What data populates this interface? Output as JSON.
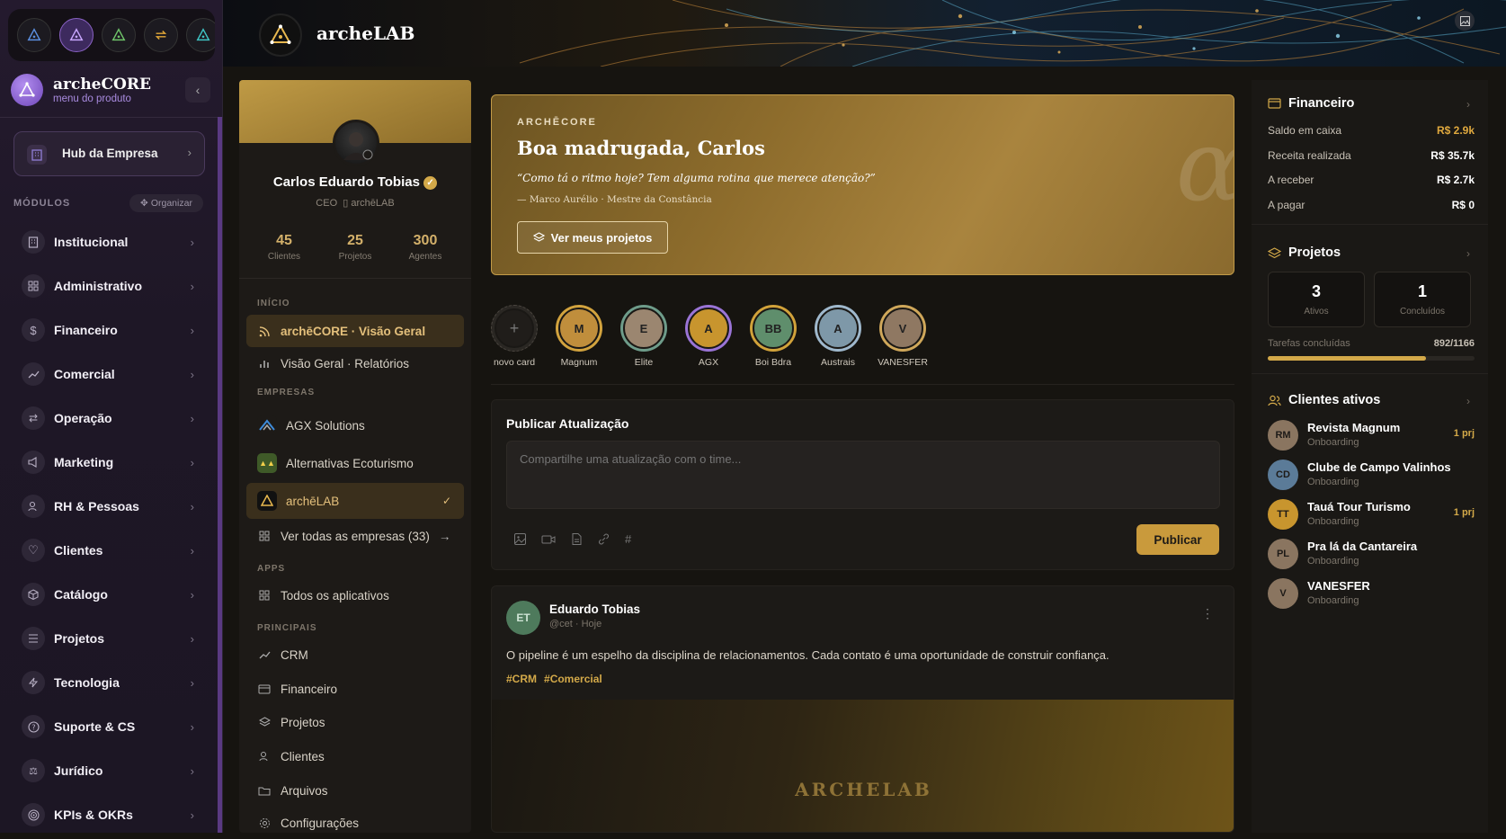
{
  "sidebar": {
    "brand_name": "archeCORE",
    "brand_sub": "menu do produto",
    "hub_label": "Hub da Empresa",
    "modules_heading": "MÓDULOS",
    "organize_label": "Organizar",
    "modules": [
      {
        "label": "Institucional",
        "icon": "building-icon"
      },
      {
        "label": "Administrativo",
        "icon": "grid-icon"
      },
      {
        "label": "Financeiro",
        "icon": "dollar-icon"
      },
      {
        "label": "Comercial",
        "icon": "trend-icon"
      },
      {
        "label": "Operação",
        "icon": "cycle-icon"
      },
      {
        "label": "Marketing",
        "icon": "megaphone-icon"
      },
      {
        "label": "RH & Pessoas",
        "icon": "people-icon"
      },
      {
        "label": "Clientes",
        "icon": "heart-icon"
      },
      {
        "label": "Catálogo",
        "icon": "box-icon"
      },
      {
        "label": "Projetos",
        "icon": "list-icon"
      },
      {
        "label": "Tecnologia",
        "icon": "bolt-icon"
      },
      {
        "label": "Suporte & CS",
        "icon": "help-icon"
      },
      {
        "label": "Jurídico",
        "icon": "scale-icon"
      },
      {
        "label": "KPIs & OKRs",
        "icon": "target-icon"
      }
    ]
  },
  "banner": {
    "title": "archeLAB"
  },
  "profile": {
    "name": "Carlos Eduardo Tobias",
    "role": "CEO",
    "company": "archēLAB",
    "stats": [
      {
        "value": "45",
        "label": "Clientes"
      },
      {
        "value": "25",
        "label": "Projetos"
      },
      {
        "value": "300",
        "label": "Agentes"
      }
    ],
    "sec_inicio": "INÍCIO",
    "nav_overview": "archēCORE · Visão Geral",
    "nav_reports": "Visão Geral · Relatórios",
    "sec_empresas": "EMPRESAS",
    "companies": [
      "AGX Solutions",
      "Alternativas Ecoturismo",
      "archēLAB"
    ],
    "see_all": "Ver todas as empresas (33)",
    "sec_apps": "APPS",
    "all_apps": "Todos os aplicativos",
    "sec_principais": "PRINCIPAIS",
    "principais": [
      "CRM",
      "Financeiro",
      "Projetos",
      "Clientes",
      "Arquivos",
      "Configurações"
    ]
  },
  "hero": {
    "eyebrow": "ARCHĒCORE",
    "title": "Boa madrugada, Carlos",
    "quote": "“Como tá o ritmo hoje? Tem alguma rotina que merece atenção?”",
    "author": "— Marco Aurélio · Mestre da Constância",
    "button": "Ver meus projetos",
    "glyph": "α"
  },
  "stories": [
    {
      "label": "novo card",
      "initials": "+",
      "ring": "#2a2723",
      "fill": "#201d1a"
    },
    {
      "label": "Magnum",
      "initials": "M",
      "ring": "#d2a33e",
      "fill": "#c08e3c"
    },
    {
      "label": "Elite",
      "initials": "E",
      "ring": "#6e9c8a",
      "fill": "#9b8670"
    },
    {
      "label": "AGX",
      "initials": "A",
      "ring": "#9a74d6",
      "fill": "#c8952e"
    },
    {
      "label": "Boi Bdra",
      "initials": "BB",
      "ring": "#d1a23a",
      "fill": "#5f8e6c"
    },
    {
      "label": "Austrais",
      "initials": "A",
      "ring": "#9fb8cc",
      "fill": "#7e98a8"
    },
    {
      "label": "VANESFER",
      "initials": "V",
      "ring": "#cfa75a",
      "fill": "#8f7862"
    }
  ],
  "composer": {
    "title": "Publicar Atualização",
    "placeholder": "Compartilhe uma atualização com o time...",
    "publish": "Publicar"
  },
  "post": {
    "initials": "ET",
    "author": "Eduardo Tobias",
    "meta": "@cet · Hoje",
    "text": "O pipeline é um espelho da disciplina de relacionamentos. Cada contato é uma oportunidade de construir confiança.",
    "tags": [
      "#CRM",
      "#Comercial"
    ],
    "image_text": "ARCHELAB"
  },
  "finance": {
    "title": "Financeiro",
    "rows": [
      {
        "label": "Saldo em caixa",
        "value": "R$ 2.9k",
        "color": "#e0a93e"
      },
      {
        "label": "Receita realizada",
        "value": "R$ 35.7k",
        "color": "#ffffff"
      },
      {
        "label": "A receber",
        "value": "R$ 2.7k",
        "color": "#ffffff"
      },
      {
        "label": "A pagar",
        "value": "R$ 0",
        "color": "#ffffff"
      }
    ]
  },
  "projects": {
    "title": "Projetos",
    "active": "3",
    "active_label": "Ativos",
    "done": "1",
    "done_label": "Concluídos",
    "tasks_label": "Tarefas concluídas",
    "tasks_value": "892/1166",
    "tasks_fraction": 0.765
  },
  "clients": {
    "title": "Clientes ativos",
    "items": [
      {
        "initials": "RM",
        "name": "Revista Magnum",
        "status": "Onboarding",
        "projects": "1 prj",
        "color": "#8a7560"
      },
      {
        "initials": "CD",
        "name": "Clube de Campo Valinhos",
        "status": "Onboarding",
        "projects": "",
        "color": "#5b7b98"
      },
      {
        "initials": "TT",
        "name": "Tauá Tour Turismo",
        "status": "Onboarding",
        "projects": "1 prj",
        "color": "#c8952e"
      },
      {
        "initials": "PL",
        "name": "Pra lá da Cantareira",
        "status": "Onboarding",
        "projects": "",
        "color": "#8a7560"
      },
      {
        "initials": "V",
        "name": "VANESFER",
        "status": "Onboarding",
        "projects": "",
        "color": "#8a7560"
      }
    ]
  }
}
